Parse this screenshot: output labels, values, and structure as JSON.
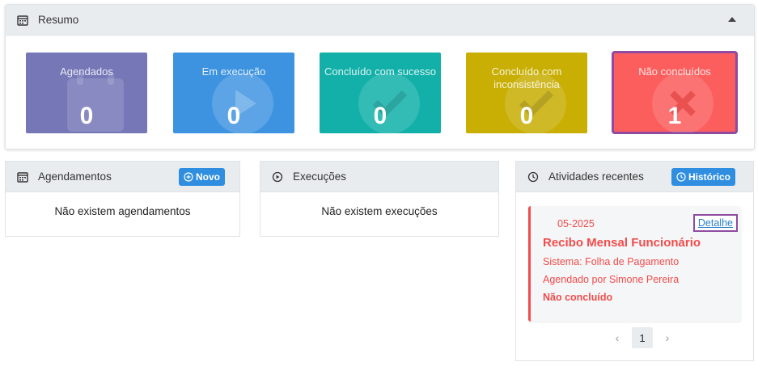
{
  "resumo": {
    "title": "Resumo",
    "cards": [
      {
        "label": "Agendados",
        "count": "0",
        "color": "#7577b7",
        "icon": "calendar-icon"
      },
      {
        "label": "Em execução",
        "count": "0",
        "color": "#3d93e0",
        "icon": "play-icon"
      },
      {
        "label": "Concluído com sucesso",
        "count": "0",
        "color": "#12b0a9",
        "icon": "check-circle-icon"
      },
      {
        "label": "Concluído com inconsistência",
        "count": "0",
        "color": "#c9ae04",
        "icon": "check-circle-icon"
      },
      {
        "label": "Não concluídos",
        "count": "1",
        "color": "#fc5d5d",
        "icon": "x-circle-icon"
      }
    ]
  },
  "agendamentos": {
    "title": "Agendamentos",
    "button": "Novo",
    "empty": "Não existem agendamentos"
  },
  "execucoes": {
    "title": "Execuções",
    "empty": "Não existem execuções"
  },
  "atividades": {
    "title": "Atividades recentes",
    "button": "Histórico",
    "item": {
      "date": "05-2025",
      "detail": "Detalhe",
      "title": "Recibo Mensal Funcionário",
      "sistema": "Sistema: Folha de Pagamento",
      "agendado": "Agendado por Simone Pereira",
      "status": "Não concluído"
    },
    "page": "1"
  }
}
